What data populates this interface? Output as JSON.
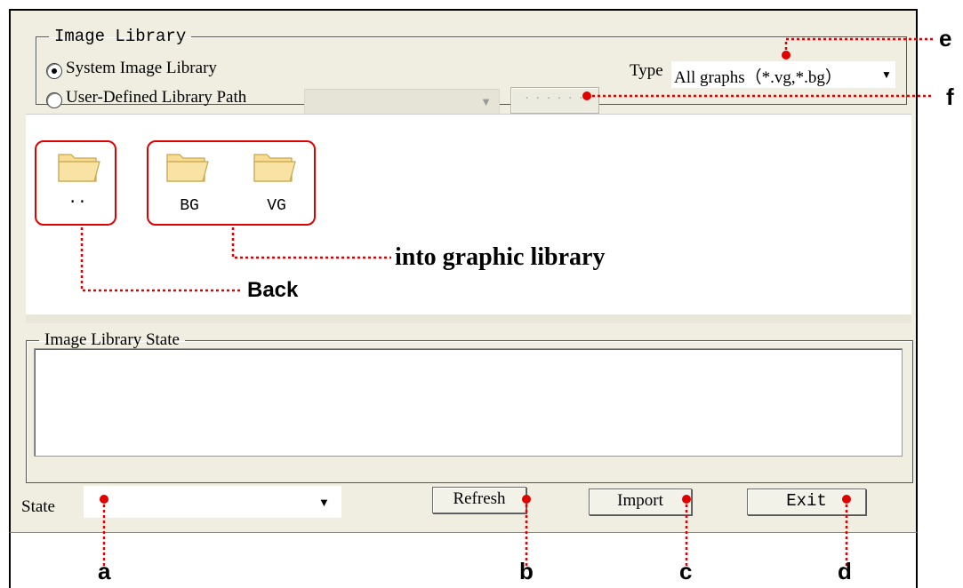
{
  "image_library": {
    "legend": "Image Library",
    "system_radio_label": "System Image Library",
    "user_radio_label": "User-Defined Library Path",
    "user_path_value": "",
    "browse_button_label": "· · · · · ·",
    "type_label": "Type",
    "type_value": "All graphs（*.vg,*.bg）"
  },
  "folders": [
    {
      "name": ".."
    },
    {
      "name": "BG"
    },
    {
      "name": "VG"
    }
  ],
  "state_group": {
    "legend": "Image Library State",
    "text": ""
  },
  "bottom": {
    "state_label": "State",
    "state_value": "",
    "refresh_label": "Refresh",
    "import_label": "Import",
    "exit_label": "Exit"
  },
  "annotations": {
    "a": "a",
    "b": "b",
    "c": "c",
    "d": "d",
    "e": "e",
    "f": "f",
    "back": "Back",
    "into": "into graphic library"
  },
  "colors": {
    "annotation": "#e00000",
    "dialog_bg": "#efeee1",
    "folder": "#f5d37c"
  }
}
